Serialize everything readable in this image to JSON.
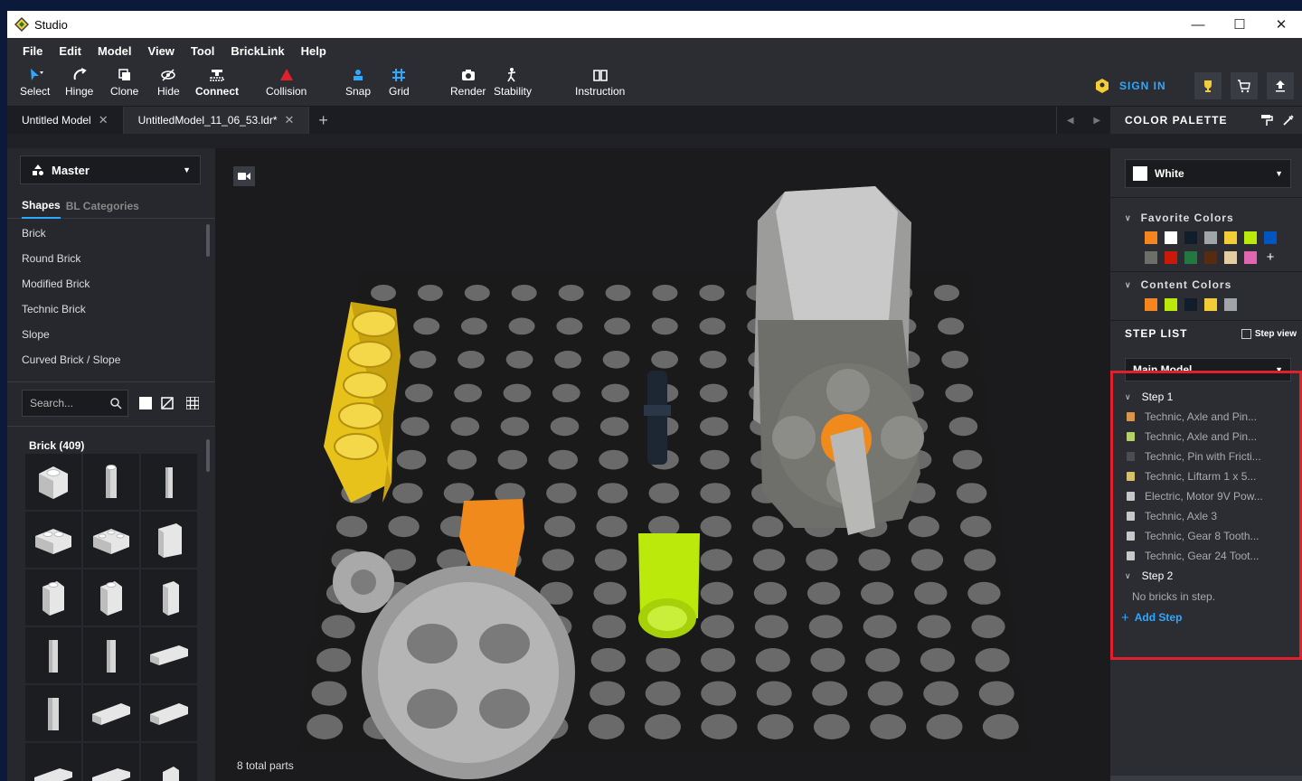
{
  "window": {
    "title": "Studio"
  },
  "menu": [
    "File",
    "Edit",
    "Model",
    "View",
    "Tool",
    "BrickLink",
    "Help"
  ],
  "toolbar": {
    "select": "Select",
    "hinge": "Hinge",
    "clone": "Clone",
    "hide": "Hide",
    "connect": "Connect",
    "collision": "Collision",
    "snap": "Snap",
    "grid": "Grid",
    "render": "Render",
    "stability": "Stability",
    "instruction": "Instruction",
    "sign_in": "SIGN IN"
  },
  "tabs": [
    {
      "label": "Untitled Model"
    },
    {
      "label": "UntitledModel_11_06_53.ldr*"
    }
  ],
  "left_panel": {
    "master": "Master",
    "subtabs": [
      "Shapes",
      "BL Categories"
    ],
    "shapes": [
      "Brick",
      "Round Brick",
      "Modified Brick",
      "Technic Brick",
      "Slope",
      "Curved Brick / Slope"
    ],
    "search_placeholder": "Search...",
    "brick_category": "Brick (409)"
  },
  "viewport": {
    "parts_count": "8 total parts"
  },
  "color_palette": {
    "header": "COLOR PALETTE",
    "selected": "White",
    "favorite_label": "Favorite Colors",
    "favorite_colors": [
      "#f5851f",
      "#ffffff",
      "#101d2a",
      "#a0a5a9",
      "#f2cd37",
      "#bbe90b",
      "#0055bf",
      "#6c6e68",
      "#c91a09",
      "#237841",
      "#582a12",
      "#e4cd9e",
      "#e066b0"
    ],
    "content_label": "Content Colors",
    "content_colors": [
      "#f5851f",
      "#bbe90b",
      "#101d2a",
      "#f2cd37",
      "#a0a5a9"
    ]
  },
  "step_list": {
    "header": "STEP LIST",
    "step_view": "Step view",
    "model": "Main Model",
    "step1": "Step 1",
    "items": [
      {
        "label": "Technic, Axle and Pin...",
        "color": "#d9954a"
      },
      {
        "label": "Technic, Axle and Pin...",
        "color": "#b5d06a"
      },
      {
        "label": "Technic, Pin with Fricti...",
        "color": "#4a4d52"
      },
      {
        "label": "Technic, Liftarm 1 x 5...",
        "color": "#d8c06a"
      },
      {
        "label": "Electric, Motor 9V Pow...",
        "color": "#c8c8c8"
      },
      {
        "label": "Technic, Axle 3",
        "color": "#c8c8c8"
      },
      {
        "label": "Technic, Gear 8 Tooth...",
        "color": "#c8c8c8"
      },
      {
        "label": "Technic, Gear 24 Toot...",
        "color": "#c8c8c8"
      }
    ],
    "step2": "Step 2",
    "no_bricks": "No bricks in step.",
    "add_step": "Add Step"
  }
}
